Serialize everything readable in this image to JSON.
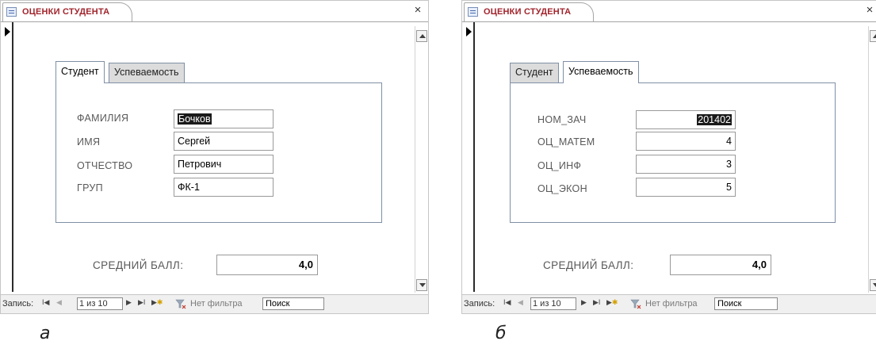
{
  "windows": [
    {
      "id": "a",
      "title": "ОЦЕНКИ СТУДЕНТА",
      "close": "×",
      "tabs": [
        "Студент",
        "Успеваемость"
      ],
      "active_tab": 0,
      "fields": [
        {
          "label": "ФАМИЛИЯ",
          "value": "Бочков"
        },
        {
          "label": "ИМЯ",
          "value": "Сергей"
        },
        {
          "label": "ОТЧЕСТВО",
          "value": "Петрович"
        },
        {
          "label": "ГРУП",
          "value": "ФК-1"
        }
      ],
      "average_label": "СРЕДНИЙ БАЛЛ:",
      "average_value": "4,0",
      "nav": {
        "label": "Запись:",
        "counter": "1 из 10",
        "filter": "Нет фильтра",
        "search": "Поиск"
      },
      "caption": "а"
    },
    {
      "id": "b",
      "title": "ОЦЕНКИ СТУДЕНТА",
      "close": "×",
      "tabs": [
        "Студент",
        "Успеваемость"
      ],
      "active_tab": 1,
      "fields": [
        {
          "label": "НОМ_ЗАЧ",
          "value": "201402"
        },
        {
          "label": "ОЦ_МАТЕМ",
          "value": "4"
        },
        {
          "label": "ОЦ_ИНФ",
          "value": "3"
        },
        {
          "label": "ОЦ_ЭКОН",
          "value": "5"
        }
      ],
      "average_label": "СРЕДНИЙ БАЛЛ:",
      "average_value": "4,0",
      "nav": {
        "label": "Запись:",
        "counter": "1 из 10",
        "filter": "Нет фильтра",
        "search": "Поиск"
      },
      "caption": "б"
    }
  ],
  "colors": {
    "title": "#a1242c",
    "tab_border": "#7f8fa6",
    "selection": "#1a1a1a"
  },
  "icons": [
    "form-icon",
    "record-selector-icon",
    "filter-icon",
    "first-record-icon",
    "prev-record-icon",
    "next-record-icon",
    "last-record-icon",
    "new-record-icon"
  ]
}
